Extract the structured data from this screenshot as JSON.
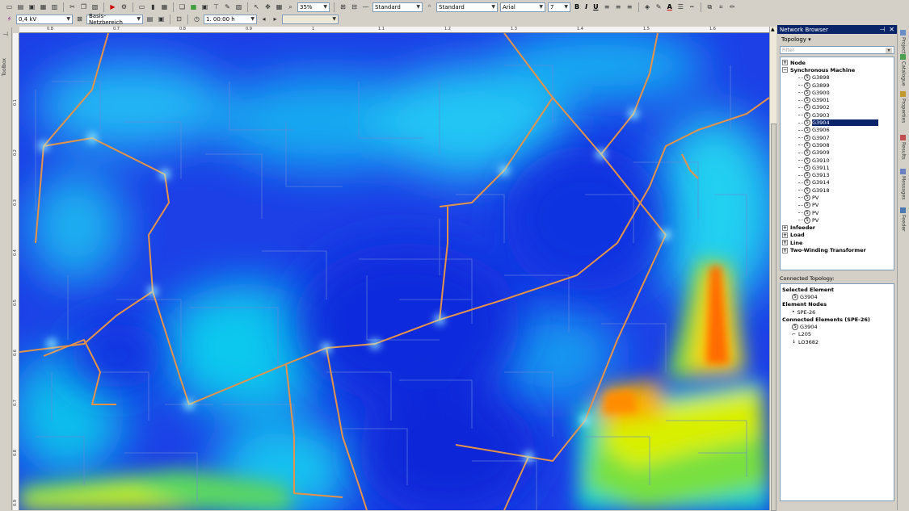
{
  "toolbar": {
    "row1": {
      "zoom_value": "35%",
      "line_style_1": "Standard",
      "line_style_2": "Standard",
      "font_name": "Arial",
      "font_size": "7",
      "bold": "B",
      "italic": "I",
      "underline": "U",
      "text_color_glyph": "A"
    },
    "row2": {
      "voltage_value": "0,4 kV",
      "area_value": "Basis-Netzbereich",
      "time_value": "1. 00:00 h"
    }
  },
  "left_strip": {
    "label": "Toolbox"
  },
  "ruler": {
    "top_ticks": [
      "0.8",
      "0.7",
      "0.8",
      "0.9",
      "1",
      "1.1",
      "1.2",
      "1.3",
      "1.4",
      "1.5",
      "1.6"
    ],
    "left_ticks": [
      "0.1",
      "0.2",
      "0.3",
      "0.4",
      "0.5",
      "0.6",
      "0.7",
      "0.8",
      "0.9"
    ]
  },
  "network_browser": {
    "title": "Network Browser",
    "pin_glyph": "⊣",
    "close_glyph": "✕",
    "tab": "Topology ▾",
    "filter_placeholder": "Filter",
    "tree": {
      "node": {
        "label": "Node",
        "expander": "+"
      },
      "synchronous_machine": {
        "label": "Synchronous Machine",
        "expander": "−",
        "children": [
          "G3898",
          "G3899",
          "G3900",
          "G3901",
          "G3902",
          "G3903",
          "G3904",
          "G3906",
          "G3907",
          "G3908",
          "G3909",
          "G3910",
          "G3911",
          "G3913",
          "G3914",
          "G3918",
          "PV",
          "PV",
          "PV",
          "PV"
        ],
        "selected": "G3904"
      },
      "infeeder": {
        "label": "Infeeder",
        "expander": "+"
      },
      "load": {
        "label": "Load",
        "expander": "+"
      },
      "line": {
        "label": "Line",
        "expander": "+"
      },
      "two_winding_transformer": {
        "label": "Two-Winding Transformer",
        "expander": "+"
      }
    },
    "connected_topology": {
      "label": "Connected Topology:",
      "selected_element_header": "Selected Element",
      "selected_element": "G3904",
      "element_nodes_header": "Element Nodes",
      "element_node": "SPE-26",
      "connected_elements_header": "Connected Elements (SPE-26)",
      "connected_elements": [
        "G3904",
        "L205",
        "LO3682"
      ]
    }
  },
  "right_tabs": [
    "Project",
    "Catalogue",
    "Properties",
    "Results",
    "Messages",
    "Feeder"
  ],
  "colors": {
    "map_low": "#1a3ee8",
    "map_mid": "#00d8f0",
    "map_high_yellow": "#f4f000",
    "map_peak": "#ff5a00",
    "feeder_line": "#e0904a",
    "selection": "#0a246a"
  },
  "icons": {
    "synchronous_machine": "S"
  }
}
